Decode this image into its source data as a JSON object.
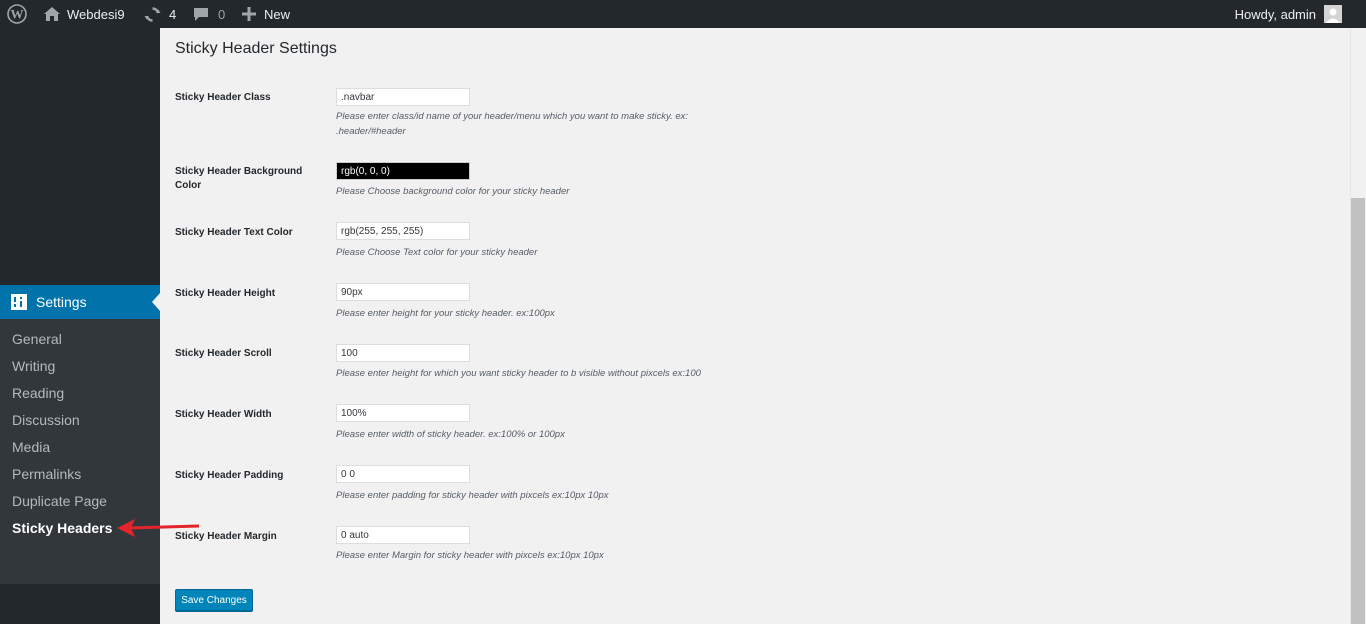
{
  "adminbar": {
    "site_name": "Webdesi9",
    "updates_count": "4",
    "comments_count": "0",
    "new_label": "New",
    "howdy": "Howdy, admin"
  },
  "sidebar": {
    "settings_label": "Settings",
    "submenu": [
      {
        "label": "General"
      },
      {
        "label": "Writing"
      },
      {
        "label": "Reading"
      },
      {
        "label": "Discussion"
      },
      {
        "label": "Media"
      },
      {
        "label": "Permalinks"
      },
      {
        "label": "Duplicate Page"
      },
      {
        "label": "Sticky Headers",
        "current": true
      }
    ]
  },
  "page": {
    "title": "Sticky Header Settings",
    "fields": [
      {
        "label": "Sticky Header Class",
        "value": ".navbar",
        "desc_1": "Please enter class/id name of your header/menu which you want to make sticky. ex:",
        "desc_2": ".header/#header"
      },
      {
        "label": "Sticky Header Background Color",
        "value": "rgb(0, 0, 0)",
        "desc_1": "Please Choose background color for your sticky header"
      },
      {
        "label": "Sticky Header Text Color",
        "value": "rgb(255, 255, 255)",
        "desc_1": "Please Choose Text color for your sticky header"
      },
      {
        "label": "Sticky Header Height",
        "value": "90px",
        "desc_1": "Please enter height for your sticky header. ex:100px"
      },
      {
        "label": "Sticky Header Scroll",
        "value": "100",
        "desc_1": "Please enter height for which you want sticky header to b visible without pixcels ex:100"
      },
      {
        "label": "Sticky Header Width",
        "value": "100%",
        "desc_1": "Please enter width of sticky header. ex:100% or 100px"
      },
      {
        "label": "Sticky Header Padding",
        "value": "0 0",
        "desc_1": "Please enter padding for sticky header with pixcels ex:10px 10px"
      },
      {
        "label": "Sticky Header Margin",
        "value": "0 auto",
        "desc_1": "Please enter Margin for sticky header with pixcels ex:10px 10px"
      }
    ],
    "save_label": "Save Changes"
  },
  "colors": {
    "accent": "#0073aa",
    "button": "#0085ba",
    "sidebar": "#23282d",
    "submenu": "#32373c",
    "annotation_arrow": "#e3242b"
  },
  "icons": {
    "wp_logo": "wordpress-logo-icon",
    "site": "home-icon",
    "updates": "refresh-icon",
    "comments": "comment-icon",
    "new": "plus-icon",
    "settings": "settings-sliders-icon",
    "annotation": "red-arrow-icon"
  }
}
